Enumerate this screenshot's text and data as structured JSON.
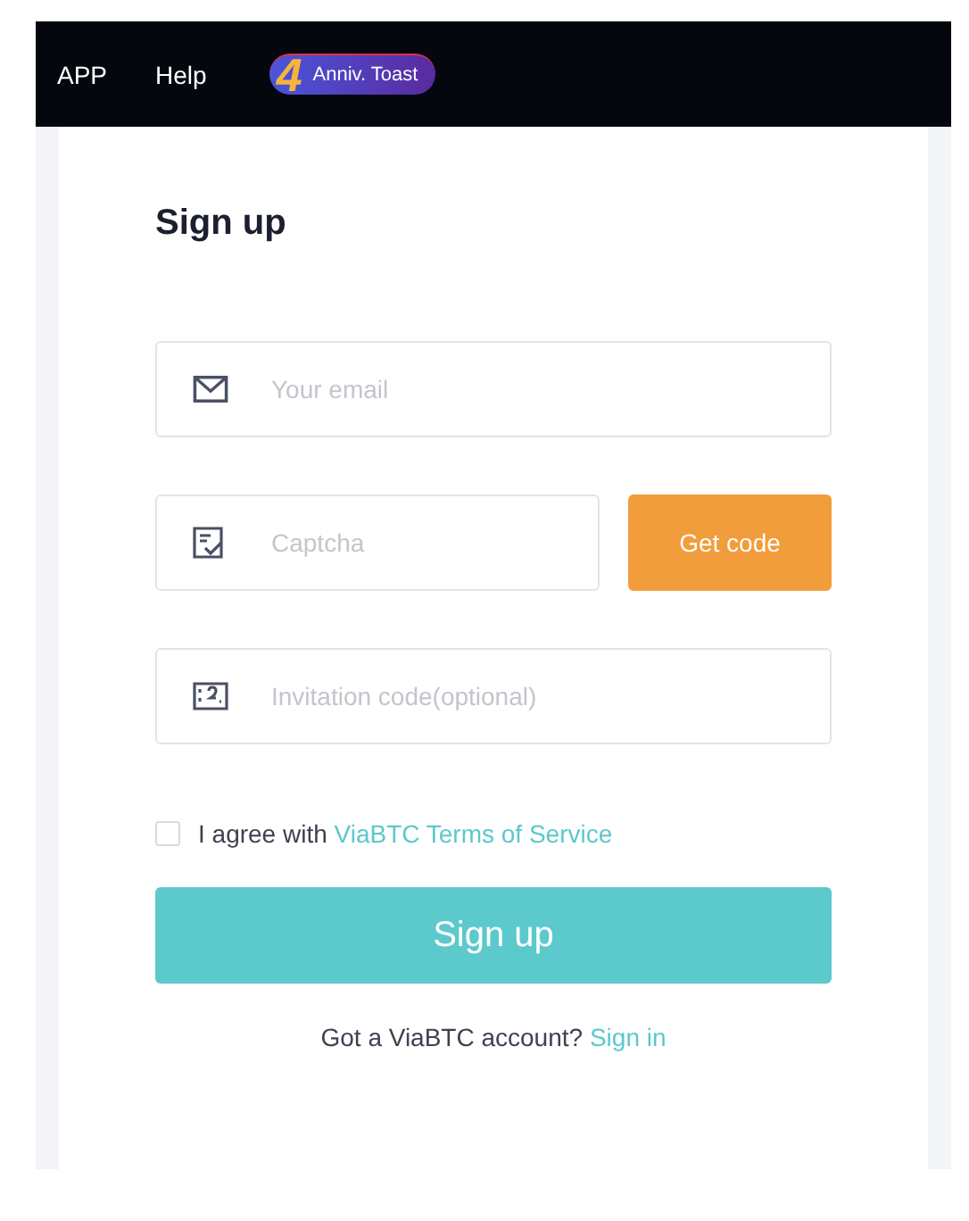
{
  "nav": {
    "items": [
      "APP",
      "Help"
    ],
    "promo": {
      "number": "4",
      "label": "Anniv. Toast"
    }
  },
  "form": {
    "title": "Sign up",
    "fields": [
      {
        "kind": "email",
        "placeholder": "Your email"
      },
      {
        "kind": "captcha",
        "placeholder": "Captcha",
        "button": "Get code"
      },
      {
        "kind": "invite",
        "placeholder": "Invitation code(optional)"
      }
    ],
    "agree": {
      "checked": false,
      "text": "I agree with",
      "link": "ViaBTC Terms of Service"
    },
    "submit": "Sign up",
    "footer": {
      "text": "Got a ViaBTC account?",
      "link": "Sign in"
    }
  }
}
